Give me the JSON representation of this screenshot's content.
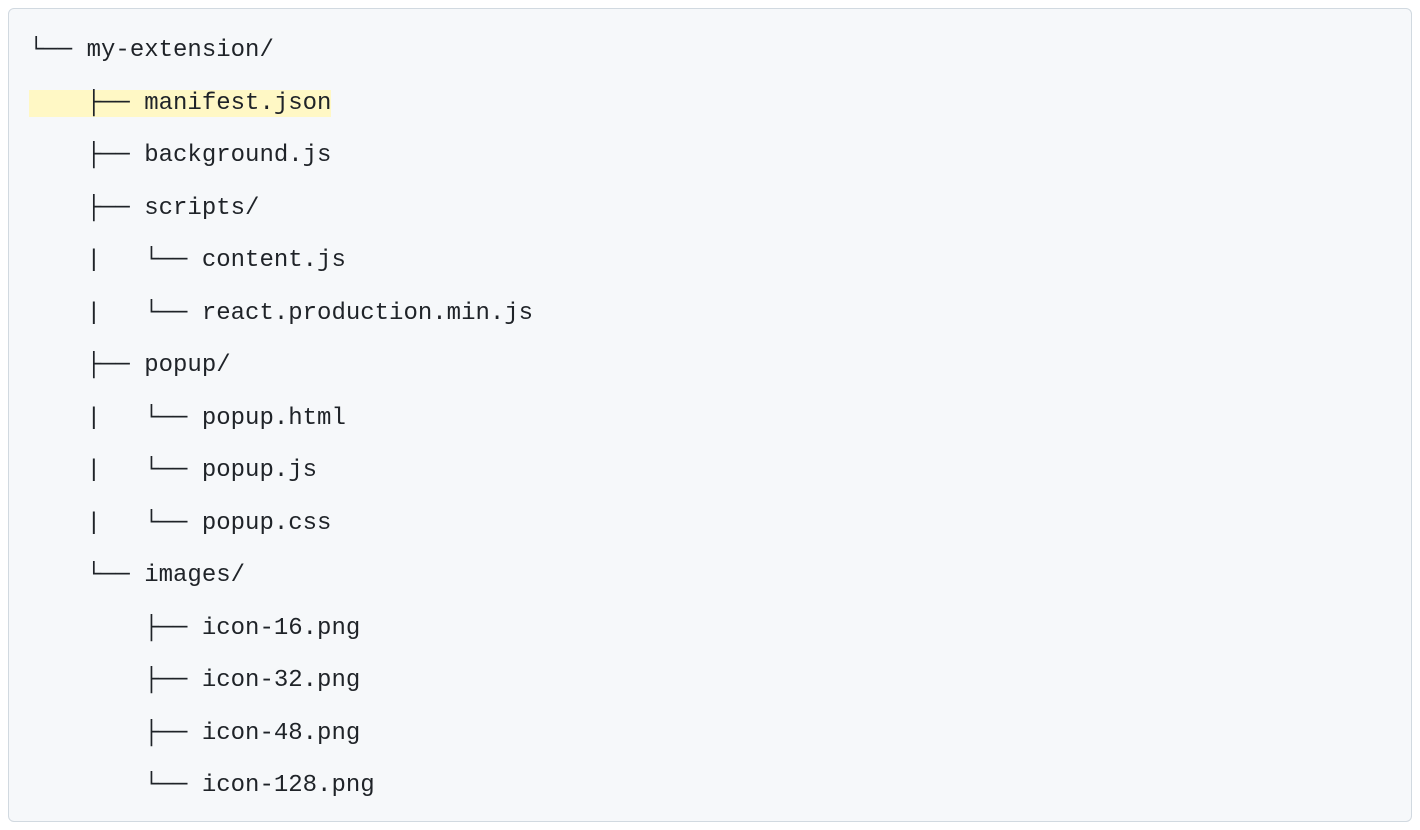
{
  "lines": [
    {
      "prefix": "└── ",
      "name": "my-extension/",
      "highlighted": false
    },
    {
      "prefix": "    ├── ",
      "name": "manifest.json",
      "highlighted": true
    },
    {
      "prefix": "    ├── ",
      "name": "background.js",
      "highlighted": false
    },
    {
      "prefix": "    ├── ",
      "name": "scripts/",
      "highlighted": false
    },
    {
      "prefix": "    |   └── ",
      "name": "content.js",
      "highlighted": false
    },
    {
      "prefix": "    |   └── ",
      "name": "react.production.min.js",
      "highlighted": false
    },
    {
      "prefix": "    ├── ",
      "name": "popup/",
      "highlighted": false
    },
    {
      "prefix": "    |   └── ",
      "name": "popup.html",
      "highlighted": false
    },
    {
      "prefix": "    |   └── ",
      "name": "popup.js",
      "highlighted": false
    },
    {
      "prefix": "    |   └── ",
      "name": "popup.css",
      "highlighted": false
    },
    {
      "prefix": "    └── ",
      "name": "images/",
      "highlighted": false
    },
    {
      "prefix": "        ├── ",
      "name": "icon-16.png",
      "highlighted": false
    },
    {
      "prefix": "        ├── ",
      "name": "icon-32.png",
      "highlighted": false
    },
    {
      "prefix": "        ├── ",
      "name": "icon-48.png",
      "highlighted": false
    },
    {
      "prefix": "        └── ",
      "name": "icon-128.png",
      "highlighted": false
    }
  ]
}
